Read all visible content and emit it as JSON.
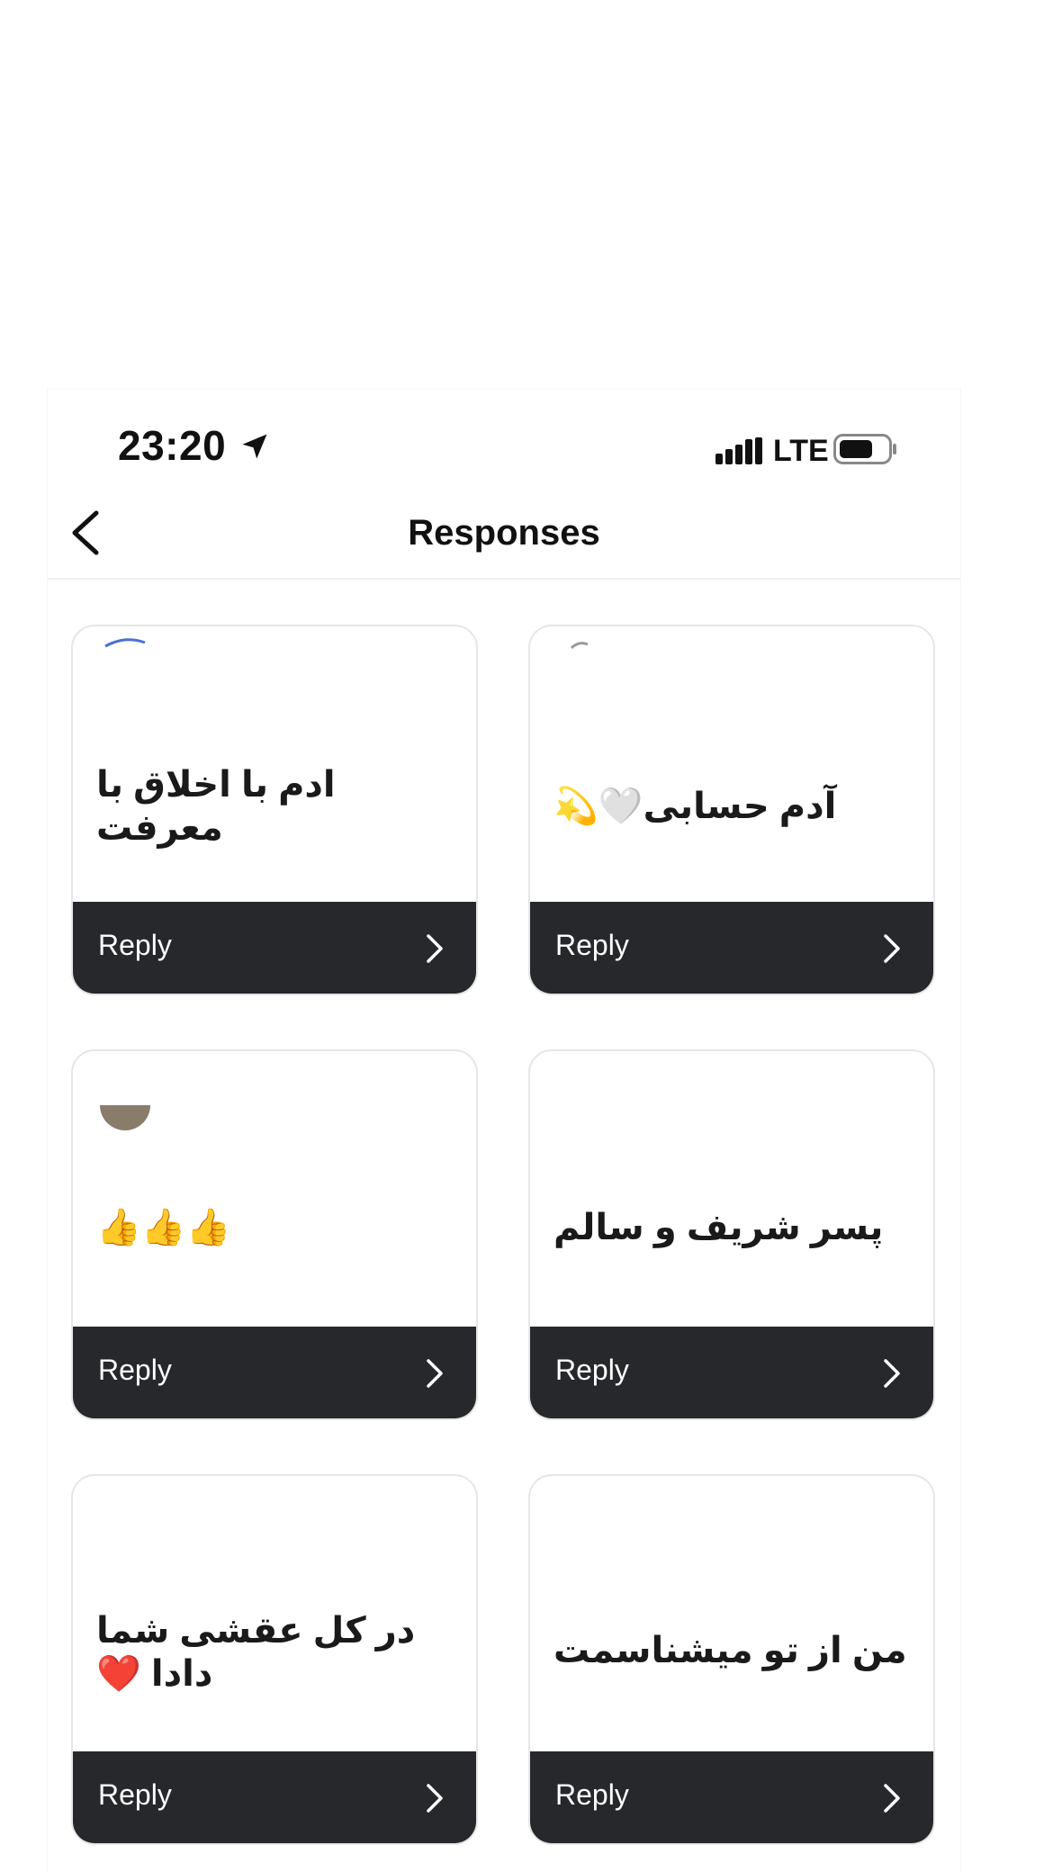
{
  "status_bar": {
    "time": "23:20",
    "network": "LTE",
    "icons": [
      "location-arrow-icon",
      "signal-icon",
      "battery-icon"
    ]
  },
  "nav": {
    "title": "Responses",
    "back_icon": "chevron-left-icon"
  },
  "responses": [
    {
      "text": "ادم با اخلاق با معرفت",
      "reply_label": "Reply"
    },
    {
      "text": "آدم حسابی🤍💫",
      "reply_label": "Reply"
    },
    {
      "text": "👍👍👍",
      "reply_label": "Reply"
    },
    {
      "text": "پسر شریف و سالم",
      "reply_label": "Reply"
    },
    {
      "text": "در کل عقشی شما دادا ❤️",
      "reply_label": "Reply"
    },
    {
      "text": "من از تو میشناسمت",
      "reply_label": "Reply"
    }
  ],
  "colors": {
    "reply_bar": "#26282c",
    "card_border": "#e6e6e6",
    "text": "#111111"
  }
}
